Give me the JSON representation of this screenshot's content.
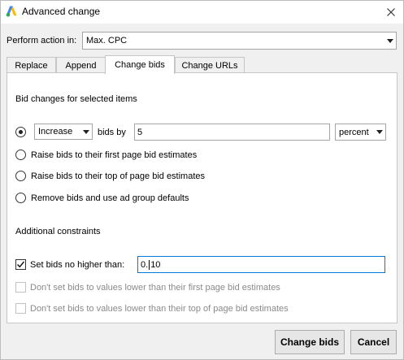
{
  "window": {
    "title": "Advanced change",
    "close_glyph": "✕"
  },
  "perform": {
    "label": "Perform action in:",
    "value": "Max. CPC"
  },
  "tabs": [
    {
      "label": "Replace"
    },
    {
      "label": "Append"
    },
    {
      "label": "Change bids",
      "active": true
    },
    {
      "label": "Change URLs"
    }
  ],
  "bid_section": {
    "heading": "Bid changes for selected items",
    "direction_value": "Increase",
    "bids_by_label": "bids by",
    "amount_value": "5",
    "unit_value": "percent",
    "options": [
      {
        "label": "Raise bids to their first page bid estimates"
      },
      {
        "label": "Raise bids to their top of page bid estimates"
      },
      {
        "label": "Remove bids and use ad group defaults"
      }
    ]
  },
  "constraints": {
    "heading": "Additional constraints",
    "max_label": "Set bids no higher than:",
    "max_value_before_caret": "0.",
    "max_value_after_caret": "10",
    "min_first_page_label": "Don't set bids to values lower than their first page bid estimates",
    "min_top_page_label": "Don't set bids to values lower than their top of page bid estimates"
  },
  "buttons": {
    "change_bids": "Change bids",
    "cancel": "Cancel"
  },
  "colors": {
    "ads_logo_blue": "#4285f4",
    "ads_logo_yellow": "#fbbc04",
    "ads_logo_green": "#34a853",
    "focus_border": "#0078d7"
  }
}
